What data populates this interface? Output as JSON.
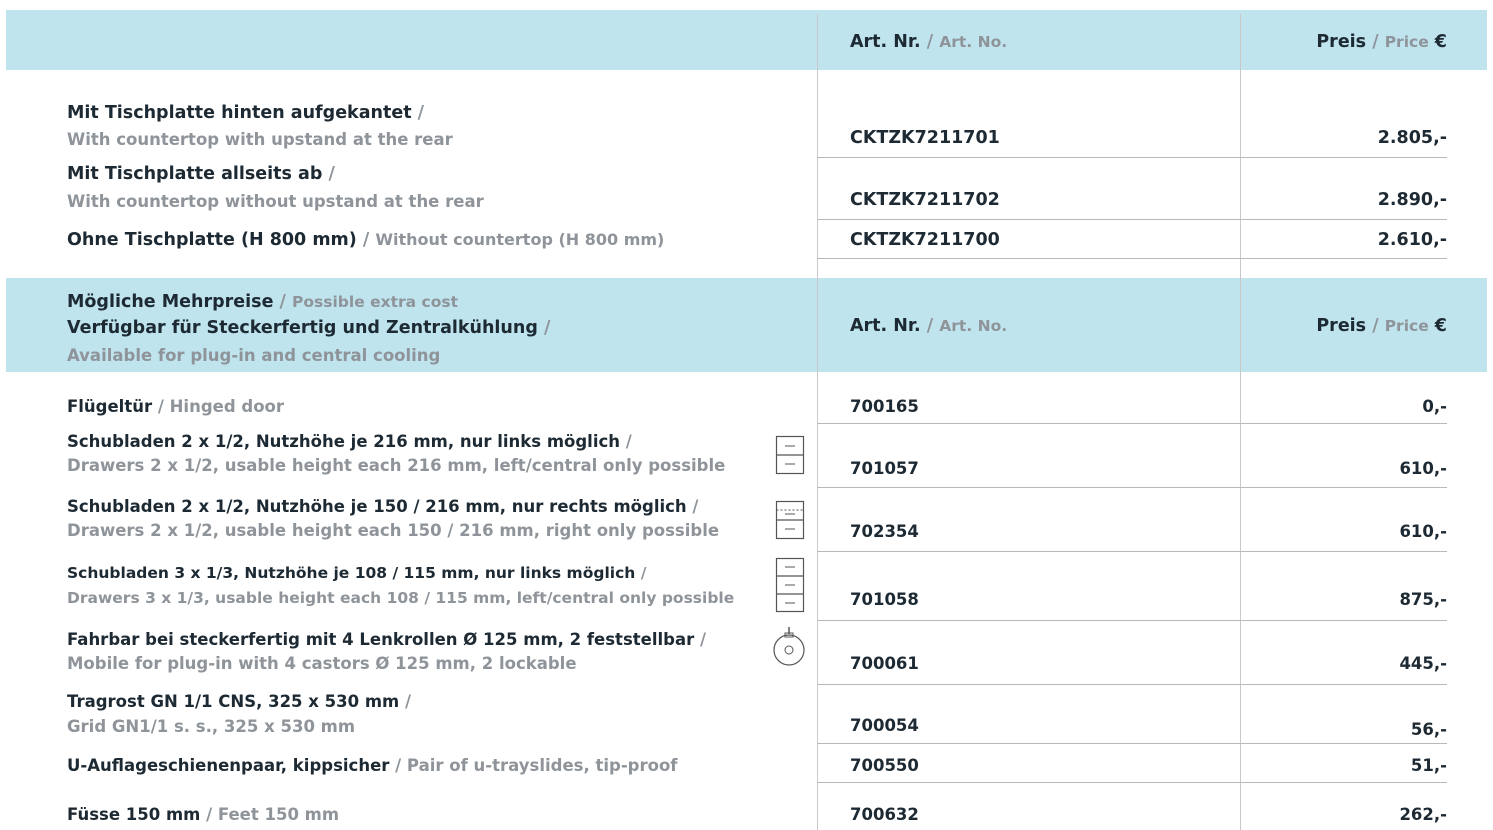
{
  "header1": {
    "art_main": "Art. Nr.",
    "art_sep": " / ",
    "art_sub": "Art. No.",
    "price_main": "Preis",
    "price_sep": " / ",
    "price_sub": "Price",
    "price_currency": " €"
  },
  "products": [
    {
      "main": "Mit Tischplatte hinten aufgekantet",
      "sep": " /",
      "sub": "With countertop with upstand at the rear",
      "art": "CKTZK7211701",
      "price": "2.805,-"
    },
    {
      "main": "Mit Tischplatte allseits ab",
      "sep": " /",
      "sub": "With countertop without upstand at the rear",
      "art": "CKTZK7211702",
      "price": "2.890,-"
    },
    {
      "main": "Ohne Tischplatte (H 800 mm)",
      "sep": " / ",
      "sub": "Without countertop (H 800 mm)",
      "art": "CKTZK7211700",
      "price": "2.610,-"
    }
  ],
  "header2": {
    "line1_main": "Mögliche Mehrpreise",
    "line1_sep": " / ",
    "line1_sub": "Possible extra cost",
    "line2_main": "Verfügbar für Steckerfertig und Zentralkühlung",
    "line2_sep": " /",
    "line3_sub": "Available for plug-in and central cooling",
    "art_main": "Art. Nr.",
    "art_sep": " / ",
    "art_sub": "Art. No.",
    "price_main": "Preis",
    "price_sep": " / ",
    "price_sub": "Price",
    "price_currency": " €"
  },
  "extras": [
    {
      "main": "Flügeltür",
      "sep": " / ",
      "sub": "Hinged door",
      "art": "700165",
      "price": "0,-",
      "icon": ""
    },
    {
      "main": "Schubladen 2 x 1/2, Nutzhöhe je 216 mm, nur links möglich",
      "sep": " /",
      "sub": "Drawers 2 x 1/2, usable height each 216 mm, left/central only possible",
      "art": "701057",
      "price": "610,-",
      "icon": "drawers-2-icon"
    },
    {
      "main": "Schubladen 2 x 1/2, Nutzhöhe je 150 / 216 mm, nur rechts möglich",
      "sep": " /",
      "sub": "Drawers 2 x 1/2, usable height each 150 / 216 mm, right only possible",
      "art": "702354",
      "price": "610,-",
      "icon": "drawers-2-dashed-icon"
    },
    {
      "main": "Schubladen 3 x 1/3, Nutzhöhe je 108 / 115 mm, nur links möglich ",
      "sep": " /",
      "sub": "Drawers 3 x 1/3, usable height each 108 / 115 mm, left/central only possible",
      "art": "701058",
      "price": "875,-",
      "icon": "drawers-3-icon"
    },
    {
      "main": "Fahrbar bei steckerfertig mit 4 Lenkrollen Ø 125 mm, 2 feststellbar",
      "sep": " /",
      "sub": "Mobile for plug-in with 4 castors Ø 125 mm, 2 lockable",
      "art": "700061",
      "price": "445,-",
      "icon": "castor-icon"
    },
    {
      "main": "Tragrost GN 1/1 CNS, 325 x 530 mm",
      "sep": " /",
      "sub": "Grid GN1/1 s. s., 325 x 530 mm",
      "art": "700054",
      "price": "56,-",
      "icon": ""
    },
    {
      "main": "U-Auflageschienenpaar, kippsicher",
      "sep": " / ",
      "sub": "Pair of u-trayslides, tip-proof",
      "art": "700550",
      "price": "51,-",
      "icon": ""
    },
    {
      "main": "Füsse 150 mm ",
      "sep": " / ",
      "sub": "Feet 150 mm",
      "art": "700632",
      "price": "262,-",
      "icon": ""
    }
  ]
}
